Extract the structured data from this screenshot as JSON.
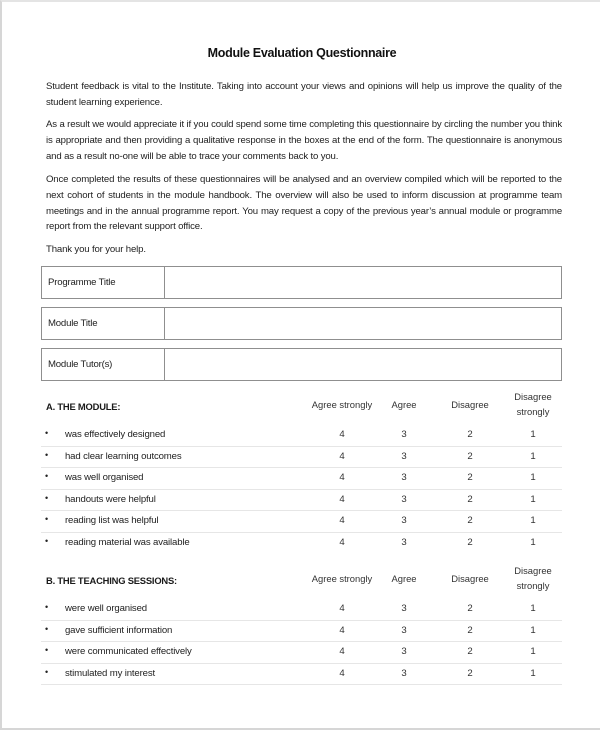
{
  "document": {
    "title": "Module Evaluation Questionnaire",
    "paragraphs": [
      "Student feedback is vital to the Institute. Taking into account your views and opinions will help us improve the quality of the student learning experience.",
      "As a result we would appreciate it if you could spend some time completing this questionnaire by circling the number you think is appropriate and then providing a qualitative response in the boxes at the end of the form. The questionnaire is anonymous and as a result no-one will be able to trace your comments back to you.",
      "Once completed the results of these questionnaires will be analysed and an overview compiled which will be reported to the next cohort of students in the module handbook.  The overview will also be used to inform discussion at programme team meetings and in the annual programme report. You may request a copy of the previous year’s annual module or programme report from the relevant support office.",
      "Thank you for your help."
    ],
    "info_fields": [
      {
        "label": "Programme Title",
        "value": ""
      },
      {
        "label": "Module Title",
        "value": ""
      },
      {
        "label": "Module Tutor(s)",
        "value": ""
      }
    ],
    "scale_headers": [
      "Agree strongly",
      "Agree",
      "Disagree",
      "Disagree strongly"
    ],
    "scale_values": [
      "4",
      "3",
      "2",
      "1"
    ],
    "bullet_icon": "•",
    "sections": [
      {
        "title": "A. THE MODULE:",
        "items": [
          "was effectively designed",
          "had clear learning outcomes",
          "was well organised",
          "handouts were helpful",
          "reading list was helpful",
          "reading material was available"
        ]
      },
      {
        "title": "B. THE TEACHING SESSIONS:",
        "items": [
          "were well organised",
          "gave sufficient information",
          "were communicated effectively",
          "stimulated my interest"
        ]
      }
    ]
  }
}
